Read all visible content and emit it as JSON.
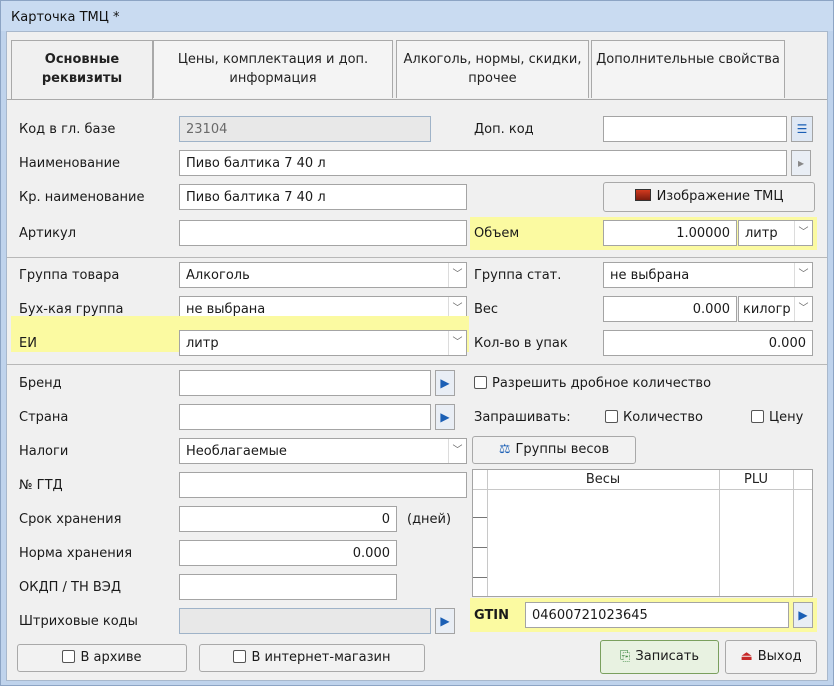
{
  "window": {
    "title": "Карточка ТМЦ *"
  },
  "tabs": [
    {
      "label": "Основные реквизиты"
    },
    {
      "label": "Цены, комплектация и доп. информация"
    },
    {
      "label": "Алкоголь, нормы, скидки, прочее"
    },
    {
      "label": "Дополнительные свойства"
    }
  ],
  "fields": {
    "code_label": "Код в гл. базе",
    "code_value": "23104",
    "extra_code_label": "Доп. код",
    "extra_code_value": "",
    "name_label": "Наименование",
    "name_value": "Пиво балтика 7 40 л",
    "short_name_label": "Кр. наименование",
    "short_name_value": "Пиво балтика 7 40 л",
    "image_button": "Изображение ТМЦ",
    "article_label": "Артикул",
    "article_value": "",
    "volume_label": "Объем",
    "volume_value": "1.00000",
    "volume_unit": "литр",
    "group_label": "Группа товара",
    "group_value": "Алкоголь",
    "stat_group_label": "Группа стат.",
    "stat_group_value": "не выбрана",
    "acc_group_label": "Бух-кая группа",
    "acc_group_value": "не выбрана",
    "weight_label": "Вес",
    "weight_value": "0.000",
    "weight_unit": "килогр",
    "unit_label": "ЕИ",
    "unit_value": "литр",
    "pack_qty_label": "Кол-во в упак",
    "pack_qty_value": "0.000",
    "brand_label": "Бренд",
    "brand_value": "",
    "country_label": "Страна",
    "country_value": "",
    "taxes_label": "Налоги",
    "taxes_value": "Необлагаемые",
    "gtd_label": "№ ГТД",
    "gtd_value": "",
    "shelf_life_label": "Срок хранения",
    "shelf_life_value": "0",
    "shelf_life_unit": "(дней)",
    "storage_norm_label": "Норма хранения",
    "storage_norm_value": "0.000",
    "okdp_label": "ОКДП / ТН ВЭД",
    "okdp_value": "",
    "barcodes_label": "Штриховые коды",
    "barcodes_value": "",
    "fractional_label": "Разрешить дробное количество",
    "ask_label": "Запрашивать:",
    "ask_qty_label": "Количество",
    "ask_price_label": "Цену",
    "weight_groups_button": "Группы весов",
    "gtin_label": "GTIN",
    "gtin_value": "04600721023645"
  },
  "grid": {
    "col1": "Весы",
    "col2": "PLU"
  },
  "footer": {
    "archive_label": "В архиве",
    "eshop_label": "В интернет-магазин",
    "save_button": "Записать",
    "exit_button": "Выход"
  },
  "colors": {
    "highlight": "#fbfaa1",
    "accent": "#1b5fb5"
  }
}
